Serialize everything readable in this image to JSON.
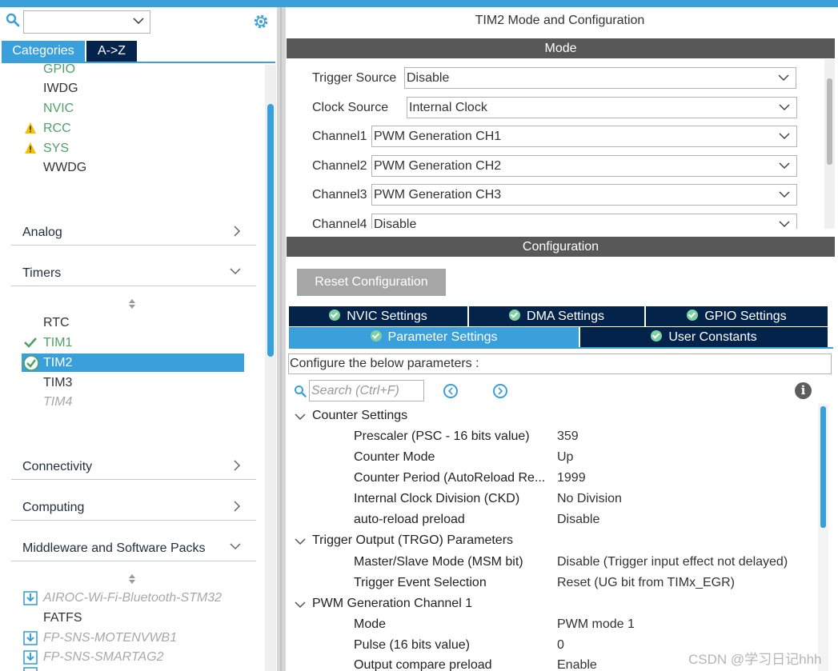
{
  "colors": {
    "accent": "#3aa0db",
    "navy": "#03234b",
    "bar": "#585858",
    "ok_green": "#4fa068",
    "warn_yellow": "#f2c200"
  },
  "left": {
    "combo_value": "",
    "tabs": {
      "categories": "Categories",
      "az": "A->Z"
    },
    "system_core_items": [
      {
        "label": "GPIO",
        "state": "ok",
        "icon": ""
      },
      {
        "label": "IWDG",
        "state": "none",
        "icon": ""
      },
      {
        "label": "NVIC",
        "state": "ok",
        "icon": ""
      },
      {
        "label": "RCC",
        "state": "warning",
        "icon": "warning-icon"
      },
      {
        "label": "SYS",
        "state": "warning",
        "icon": "warning-icon"
      },
      {
        "label": "WWDG",
        "state": "none",
        "icon": ""
      }
    ],
    "sections": {
      "analog": "Analog",
      "timers": "Timers",
      "connectivity": "Connectivity",
      "computing": "Computing",
      "middleware": "Middleware and Software Packs"
    },
    "timer_items": [
      {
        "label": "RTC",
        "state": "none"
      },
      {
        "label": "TIM1",
        "state": "checked"
      },
      {
        "label": "TIM2",
        "state": "selected"
      },
      {
        "label": "TIM3",
        "state": "none"
      },
      {
        "label": "TIM4",
        "state": "disabled"
      }
    ],
    "middleware_items": [
      {
        "label": "AIROC-Wi-Fi-Bluetooth-STM32",
        "state": "download"
      },
      {
        "label": "FATFS",
        "state": "none"
      },
      {
        "label": "FP-SNS-MOTENVWB1",
        "state": "download"
      },
      {
        "label": "FP-SNS-SMARTAG2",
        "state": "download"
      }
    ]
  },
  "right": {
    "title": "TIM2 Mode and Configuration",
    "mode_bar": "Mode",
    "mode_rows": [
      {
        "label": "Trigger Source",
        "value": "Disable"
      },
      {
        "label": "Clock Source",
        "value": "Internal Clock"
      },
      {
        "label": "Channel1",
        "value": "PWM Generation CH1"
      },
      {
        "label": "Channel2",
        "value": "PWM Generation CH2"
      },
      {
        "label": "Channel3",
        "value": "PWM Generation CH3"
      },
      {
        "label": "Channel4",
        "value": "Disable"
      }
    ],
    "config_bar": "Configuration",
    "reset_button": "Reset Configuration",
    "tabs_row1": [
      "NVIC Settings",
      "DMA Settings",
      "GPIO Settings"
    ],
    "tabs_row2": [
      "Parameter Settings",
      "User Constants"
    ],
    "configure_text": "Configure the below parameters :",
    "search_placeholder": "Search (Ctrl+F)",
    "groups": [
      {
        "title": "Counter Settings",
        "params": [
          {
            "name": "Prescaler (PSC - 16 bits value)",
            "value": "359"
          },
          {
            "name": "Counter Mode",
            "value": "Up"
          },
          {
            "name": "Counter Period (AutoReload Re...",
            "value": "1999"
          },
          {
            "name": "Internal Clock Division (CKD)",
            "value": "No Division"
          },
          {
            "name": "auto-reload preload",
            "value": "Disable"
          }
        ]
      },
      {
        "title": "Trigger Output (TRGO) Parameters",
        "params": [
          {
            "name": "Master/Slave Mode (MSM bit)",
            "value": "Disable (Trigger input effect not delayed)"
          },
          {
            "name": "Trigger Event Selection",
            "value": "Reset (UG bit from TIMx_EGR)"
          }
        ]
      },
      {
        "title": "PWM Generation Channel 1",
        "params": [
          {
            "name": "Mode",
            "value": "PWM mode 1"
          },
          {
            "name": "Pulse (16 bits value)",
            "value": "0"
          },
          {
            "name": "Output compare preload",
            "value": "Enable"
          }
        ]
      }
    ]
  },
  "watermark": "CSDN @学习日记hhh"
}
